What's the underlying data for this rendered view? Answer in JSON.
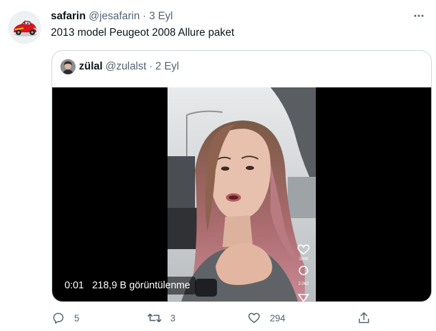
{
  "tweet": {
    "display_name": "safarin",
    "handle": "@jesafarin",
    "separator": "·",
    "time": "3 Eyl",
    "text": "2013 model Peugeot 2008 Allure paket"
  },
  "quoted_tweet": {
    "display_name": "zülal",
    "handle": "@zulalst",
    "separator": "·",
    "time": "2 Eyl",
    "video": {
      "duration": "0:01",
      "views": "218,9 B görüntülenme",
      "overlay_likes": "1948",
      "overlay_comments": "2.063"
    }
  },
  "actions": {
    "replies": "5",
    "retweets": "3",
    "likes": "294"
  },
  "icons": {
    "more": "more-icon",
    "reply": "reply-icon",
    "retweet": "retweet-icon",
    "like": "heart-icon",
    "share": "share-icon"
  },
  "colors": {
    "text_primary": "#0f1419",
    "text_secondary": "#536471",
    "border": "#cfd9de",
    "media_background": "#000000"
  }
}
